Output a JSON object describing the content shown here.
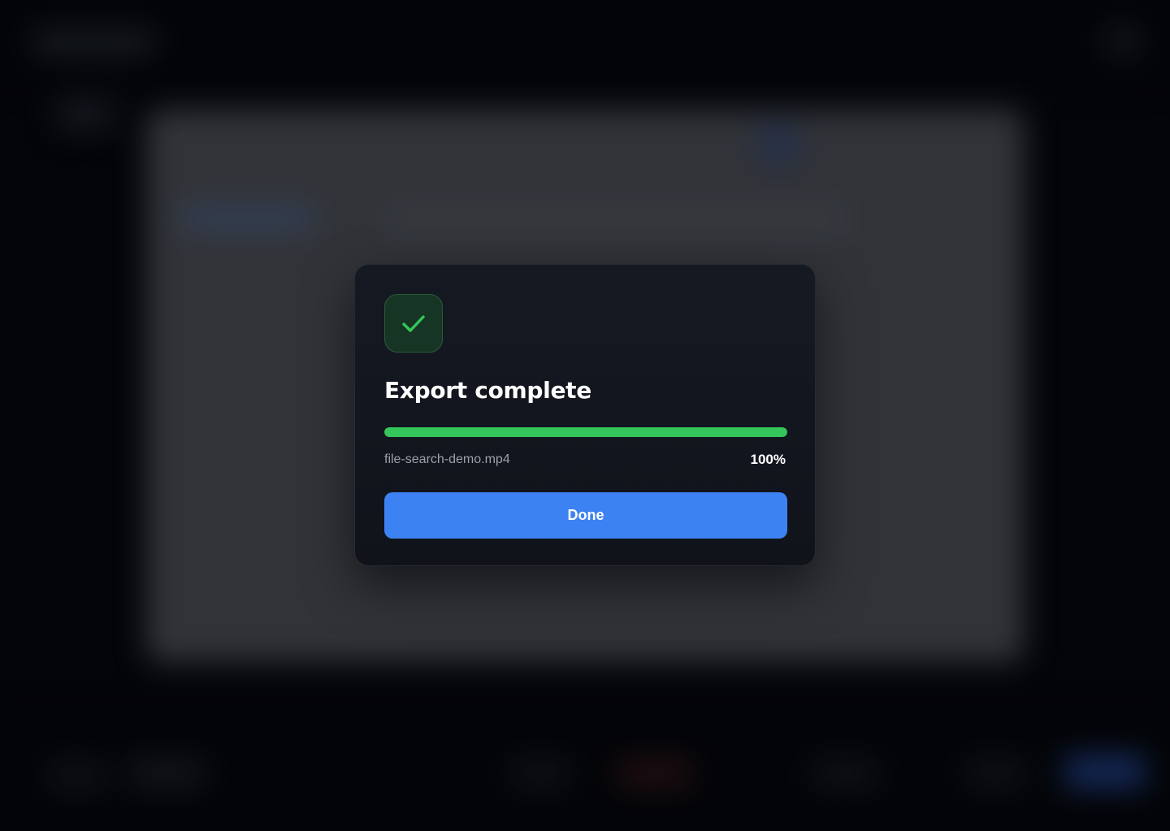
{
  "dialog": {
    "title": "Export complete",
    "status_icon": "checkmark-icon",
    "file_name": "file-search-demo.mp4",
    "progress_percent": 100,
    "progress_label": "100%",
    "done_label": "Done"
  },
  "colors": {
    "accent": "#3d82f2",
    "success": "#34c65a",
    "dialog_background": "#131720"
  }
}
